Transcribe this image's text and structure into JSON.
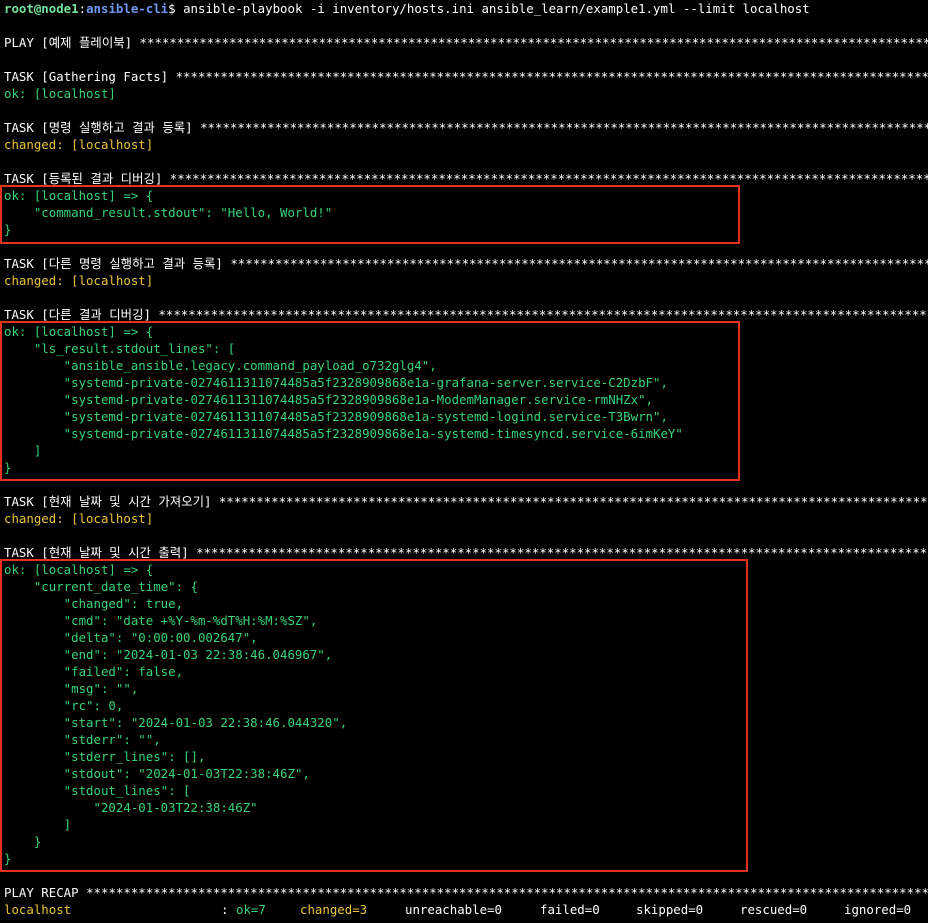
{
  "prompt": {
    "user_host": "root@node1",
    "sep": ":",
    "cwd": "ansible-cli",
    "symbol": "$",
    "command": " ansible-playbook -i inventory/hosts.ini ansible_learn/example1.yml --limit localhost"
  },
  "stars_fill": "**********************************************************************************************************************************************",
  "play": {
    "label": "PLAY [예제 플레이북] "
  },
  "tasks": [
    {
      "header": "TASK [Gathering Facts] ",
      "status": "ok: [localhost]",
      "status_color": "#37d37a"
    },
    {
      "header": "TASK [명령 실행하고 결과 등록] ",
      "status": "changed: [localhost]",
      "status_color": "#e9c33a"
    },
    {
      "header": "TASK [등록된 결과 디버깅] ",
      "body": [
        "ok: [localhost] => {",
        "    \"command_result.stdout\": \"Hello, World!\"",
        "}"
      ]
    },
    {
      "header": "TASK [다른 명령 실행하고 결과 등록] ",
      "status": "changed: [localhost]",
      "status_color": "#e9c33a"
    },
    {
      "header": "TASK [다른 결과 디버깅] ",
      "body": [
        "ok: [localhost] => {",
        "    \"ls_result.stdout_lines\": [",
        "        \"ansible_ansible.legacy.command_payload_o732glg4\",",
        "        \"systemd-private-0274611311074485a5f2328909868e1a-grafana-server.service-C2DzbF\",",
        "        \"systemd-private-0274611311074485a5f2328909868e1a-ModemManager.service-rmNHZx\",",
        "        \"systemd-private-0274611311074485a5f2328909868e1a-systemd-logind.service-T3Bwrn\",",
        "        \"systemd-private-0274611311074485a5f2328909868e1a-systemd-timesyncd.service-6imKeY\"",
        "    ]",
        "}"
      ]
    },
    {
      "header": "TASK [현재 날짜 및 시간 가져오기] ",
      "status": "changed: [localhost]",
      "status_color": "#e9c33a"
    },
    {
      "header": "TASK [현재 날짜 및 시간 출력] ",
      "body": [
        "ok: [localhost] => {",
        "    \"current_date_time\": {",
        "        \"changed\": true,",
        "        \"cmd\": \"date +%Y-%m-%dT%H:%M:%SZ\",",
        "        \"delta\": \"0:00:00.002647\",",
        "        \"end\": \"2024-01-03 22:38:46.046967\",",
        "        \"failed\": false,",
        "        \"msg\": \"\",",
        "        \"rc\": 0,",
        "        \"start\": \"2024-01-03 22:38:46.044320\",",
        "        \"stderr\": \"\",",
        "        \"stderr_lines\": [],",
        "        \"stdout\": \"2024-01-03T22:38:46Z\",",
        "        \"stdout_lines\": [",
        "            \"2024-01-03T22:38:46Z\"",
        "        ]",
        "    }",
        "}"
      ]
    }
  ],
  "recap": {
    "header": "PLAY RECAP ",
    "host": "localhost",
    "colon": ": ",
    "ok": "ok=7",
    "changed": "changed=3",
    "unreachable": "unreachable=0",
    "failed": "failed=0",
    "skipped": "skipped=0",
    "rescued": "rescued=0",
    "ignored": "ignored=0"
  },
  "colors": {
    "ok": "#37d37a",
    "changed": "#e9c33a",
    "highlight": "#e8301e",
    "prompt_user": "#74e29a",
    "prompt_path": "#6c98f0"
  }
}
